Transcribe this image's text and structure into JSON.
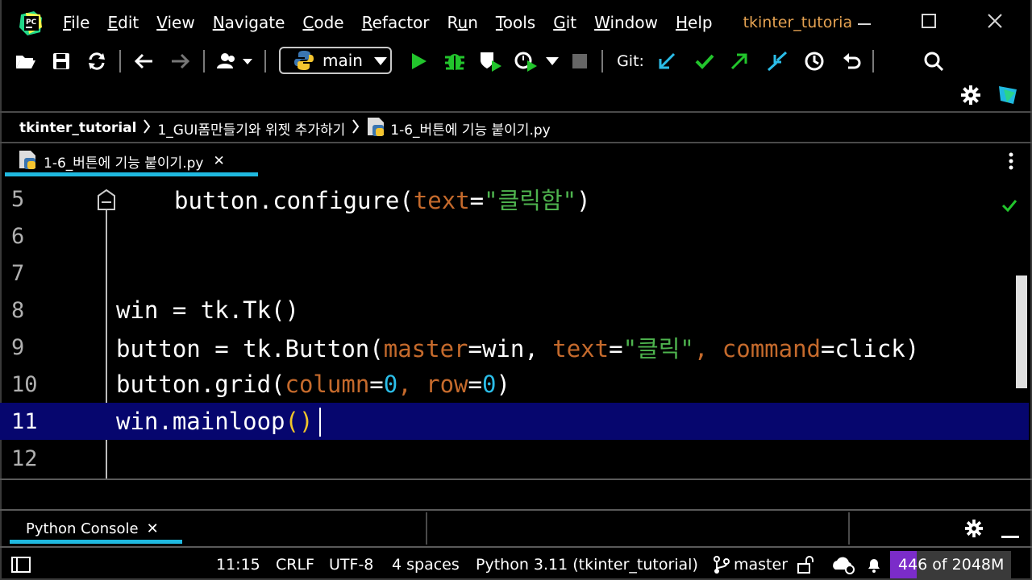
{
  "menu": {
    "items": [
      {
        "pre": "",
        "u": "F",
        "post": "ile"
      },
      {
        "pre": "",
        "u": "E",
        "post": "dit"
      },
      {
        "pre": "",
        "u": "V",
        "post": "iew"
      },
      {
        "pre": "",
        "u": "N",
        "post": "avigate"
      },
      {
        "pre": "",
        "u": "C",
        "post": "ode"
      },
      {
        "pre": "",
        "u": "R",
        "post": "efactor"
      },
      {
        "pre": "R",
        "u": "u",
        "post": "n"
      },
      {
        "pre": "",
        "u": "T",
        "post": "ools"
      },
      {
        "pre": "",
        "u": "G",
        "post": "it"
      },
      {
        "pre": "",
        "u": "W",
        "post": "indow"
      },
      {
        "pre": "",
        "u": "H",
        "post": "elp"
      }
    ],
    "project_title": "tkinter_tutoria",
    "logo_text": "PC"
  },
  "toolbar": {
    "branch": "main",
    "git_label": "Git:"
  },
  "breadcrumb": {
    "project": "tkinter_tutorial",
    "folder": "1_GUI폼만들기와 위젯 추가하기",
    "file": "1-6_버튼에 기능 붙이기.py"
  },
  "tab": {
    "label": "1-6_버튼에 기능 붙이기.py",
    "close": "✕"
  },
  "editor": {
    "lines": [
      "5",
      "6",
      "7",
      "8",
      "9",
      "10",
      "11",
      "12"
    ],
    "current_line": "11",
    "code": {
      "l5_a": "button.configure(",
      "l5_b": "text",
      "l5_c": "=",
      "l5_d": "\"클릭함\"",
      "l5_e": ")",
      "l8": "win = tk.Tk()",
      "l9_a": "button = tk.Button(",
      "l9_b": "master",
      "l9_c": "=win, ",
      "l9_d": "text",
      "l9_e": "=",
      "l9_f": "\"클릭\"",
      "l9_g": ", ",
      "l9_h": "command",
      "l9_i": "=click)",
      "l10_a": "button.grid(",
      "l10_b": "column",
      "l10_c": "=",
      "l10_d": "0",
      "l10_e": ", ",
      "l10_f": "row",
      "l10_g": "=",
      "l10_h": "0",
      "l10_i": ")",
      "l11_a": "win.mainloop",
      "l11_b": "()"
    }
  },
  "console": {
    "label": "Python Console",
    "close": "✕"
  },
  "status": {
    "position": "11:15",
    "line_sep": "CRLF",
    "encoding": "UTF-8",
    "indent": "4 spaces",
    "interpreter": "Python 3.11 (tkinter_tutorial)",
    "branch": "master",
    "memory": "446 of 2048M",
    "memory_used_fraction": 0.218
  },
  "colors": {
    "accent": "#1fb9e0",
    "line_highlight": "#06066e",
    "param": "#c56a2c",
    "string": "#4eb34e",
    "number": "#2bbde8",
    "run_green": "#22c52c",
    "memory_fill": "#7b2cc9"
  }
}
